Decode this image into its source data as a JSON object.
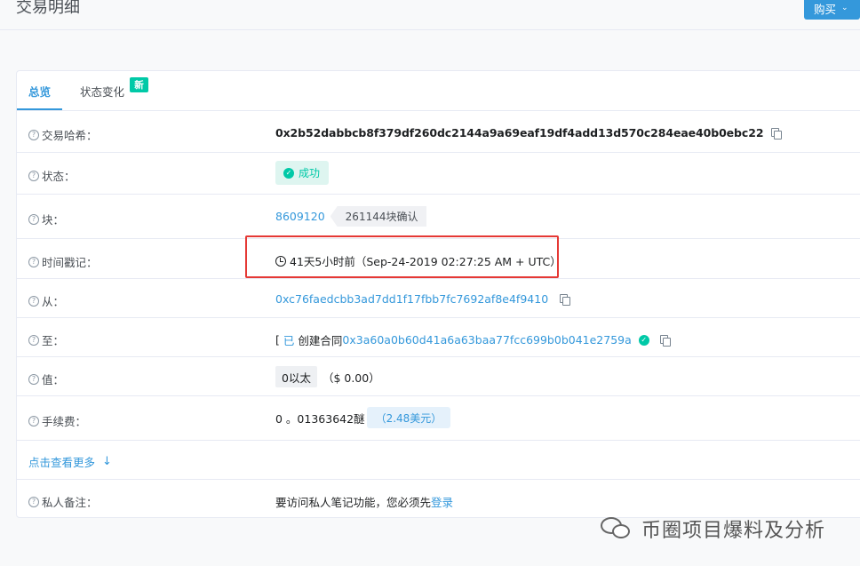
{
  "page": {
    "title": "交易明细",
    "buy_label": "购买",
    "buy_chevron": "⌄"
  },
  "tabs": {
    "overview": "总览",
    "state_change": "状态变化",
    "new_badge": "新"
  },
  "rows": {
    "tx_hash": {
      "label": "交易哈希：",
      "value": "0x2b52dabbcb8f379df260dc2144a9a69eaf19df4add13d570c284eae40b0ebc22"
    },
    "status": {
      "label": "状态：",
      "value": "成功"
    },
    "block": {
      "label": "块：",
      "number": "8609120",
      "confirmations": "261144块确认"
    },
    "timestamp": {
      "label": "时间戳记：",
      "value": "41天5小时前（Sep-24-2019 02:27:25 AM + UTC）"
    },
    "from": {
      "label": "从：",
      "value": "0xc76faedcbb3ad7dd1f17fbb7fc7692af8e4f9410"
    },
    "to": {
      "label": "至：",
      "prefix": "[",
      "created_marker": "已",
      "created_text": "创建合同",
      "address": "0x3a60a0b60d41a6a63baa77fcc699b0b041e2759a"
    },
    "value": {
      "label": "值：",
      "amount": "0以太",
      "usd": "（$ 0.00）"
    },
    "fee": {
      "label": "手续费：",
      "amount": "0 。01363642醚",
      "usd": "（2.48美元）"
    },
    "more": {
      "label": "点击查看更多"
    },
    "private_note": {
      "label": "私人备注：",
      "text": "要访问私人笔记功能，您必须先",
      "login": "登录"
    }
  },
  "watermark": {
    "text": "币圈项目爆料及分析"
  },
  "colors": {
    "accent": "#3498db",
    "success": "#00c9a7",
    "highlight": "#e53935"
  }
}
